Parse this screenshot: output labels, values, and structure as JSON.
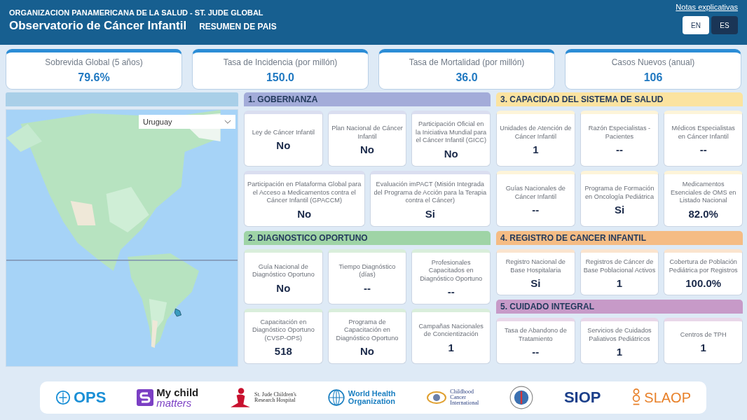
{
  "header": {
    "org": "ORGANIZACION PANAMERICANA DE LA SALUD - ST. JUDE GLOBAL",
    "title": "Observatorio de Cáncer Infantil",
    "subtitle": "RESUMEN DE PAIS",
    "notes_link": "Notas explicativas",
    "languages": [
      {
        "label": "EN",
        "selected": false
      },
      {
        "label": "ES",
        "selected": true
      }
    ]
  },
  "kpis": [
    {
      "label": "Sobrevida Global (5 años)",
      "value": "79.6%"
    },
    {
      "label": "Tasa de Incidencia (por millón)",
      "value": "150.0"
    },
    {
      "label": "Tasa de Mortalidad (por millón)",
      "value": "36.0"
    },
    {
      "label": "Casos Nuevos (anual)",
      "value": "106"
    }
  ],
  "map": {
    "country": "Uruguay"
  },
  "columns": [
    [
      {
        "title": "1. GOBERNANZA",
        "color": "#a3acd9",
        "rows": [
          [
            {
              "label": "Ley de Cáncer Infantil",
              "value": "No"
            },
            {
              "label": "Plan Nacional de Cáncer Infantil",
              "value": "No"
            },
            {
              "label": "Participación Oficial en la Iniciativa Mundial para el Cáncer Infantil (GICC)",
              "value": "No"
            }
          ],
          [
            {
              "label": "Participación en Plataforma Global para el Acceso a Medicamentos contra el Cáncer Infantil (GPACCM)",
              "value": "No"
            },
            {
              "label": "Evaluación imPACT (Misión Integrada del Programa de Acción para la Terapia contra el Cáncer)",
              "value": "Si"
            }
          ]
        ]
      },
      {
        "title": "2. DIAGNOSTICO OPORTUNO",
        "color": "#9fd4a6",
        "rows": [
          [
            {
              "label": "Guía Nacional de Diagnóstico Oportuno",
              "value": "No"
            },
            {
              "label": "Tiempo Diagnóstico (días)",
              "value": "--"
            },
            {
              "label": "Profesionales Capacitados en Diagnóstico Oportuno",
              "value": "--"
            }
          ],
          [
            {
              "label": "Capacitación en Diagnóstico Oportuno (CVSP-OPS)",
              "value": "518"
            },
            {
              "label": "Programa de Capacitación en Diagnóstico Oportuno",
              "value": "No"
            },
            {
              "label": "Campañas Nacionales de Concientización",
              "value": "1"
            }
          ]
        ]
      }
    ],
    [
      {
        "title": "3. CAPACIDAD DEL SISTEMA DE SALUD",
        "color": "#fbe3a0",
        "rows": [
          [
            {
              "label": "Unidades de Atención de Cáncer Infantil",
              "value": "1"
            },
            {
              "label": "Razón Especialistas - Pacientes",
              "value": "--"
            },
            {
              "label": "Médicos Especialistas en Cáncer Infantil",
              "value": "--"
            }
          ],
          [
            {
              "label": "Guías Nacionales de Cáncer Infantil",
              "value": "--"
            },
            {
              "label": "Programa de Formación en Oncología Pediátrica",
              "value": "Si"
            },
            {
              "label": "Medicamentos Esenciales de OMS en Listado Nacional",
              "value": "82.0%"
            }
          ]
        ]
      },
      {
        "title": "4. REGISTRO DE CANCER INFANTIL",
        "color": "#f5bc84",
        "rows": [
          [
            {
              "label": "Registro Nacional de Base Hospitalaria",
              "value": "Si"
            },
            {
              "label": "Registros de Cáncer de Base Poblacional Activos",
              "value": "1"
            },
            {
              "label": "Cobertura de Población Pediátrica por Registros",
              "value": "100.0%"
            }
          ]
        ]
      },
      {
        "title": "5. CUIDADO INTEGRAL",
        "color": "#c79ac8",
        "rows": [
          [
            {
              "label": "Tasa de Abandono de Tratamiento",
              "value": "--"
            },
            {
              "label": "Servicios de Cuidados Paliativos Pediátricos",
              "value": "1"
            },
            {
              "label": "Centros de TPH",
              "value": "1"
            }
          ]
        ]
      }
    ]
  ],
  "logos": [
    {
      "kind": "ops",
      "lines": [
        "OPS"
      ]
    },
    {
      "kind": "mcm",
      "lines": [
        "My child",
        "matters"
      ]
    },
    {
      "kind": "stjude",
      "lines": [
        "St. Jude Children's",
        "Research Hospital"
      ]
    },
    {
      "kind": "who",
      "lines": [
        "World Health",
        "Organization"
      ]
    },
    {
      "kind": "cci",
      "lines": [
        "Childhood",
        "Cancer",
        "International"
      ]
    },
    {
      "kind": "seal"
    },
    {
      "kind": "siop",
      "lines": [
        "SIOP"
      ]
    },
    {
      "kind": "slaop",
      "lines": [
        "SLAOP"
      ]
    }
  ]
}
